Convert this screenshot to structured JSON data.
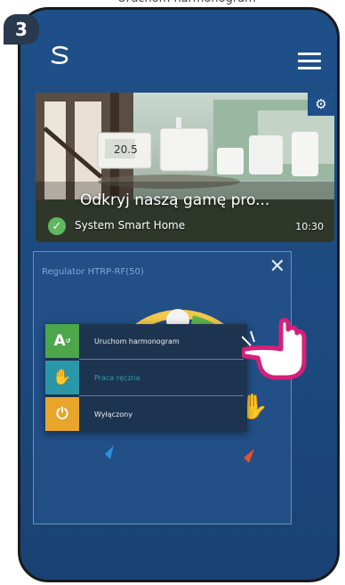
{
  "top_caption": "Uruchom harmonogram",
  "step_number": "3",
  "app_bar": {
    "logo_icon": "salus-s-logo",
    "menu_icon": "hamburger-icon"
  },
  "banner": {
    "title": "Odkryj naszą gamę pro...",
    "subtitle": "System Smart Home",
    "time": "10:30",
    "gear_icon": "gear-icon",
    "check_icon": "check-circle-icon",
    "thermostat_display": "20.5"
  },
  "dialog": {
    "title": "Regulator HTRP-RF(50)",
    "close_icon": "close-icon",
    "mode_icon": "hand-icon"
  },
  "menu": {
    "items": [
      {
        "label": "Uruchom harmonogram",
        "icon": "schedule-a-icon",
        "color": "#4ca74a",
        "glyph": "A"
      },
      {
        "label": "Praca ręczna",
        "icon": "hand-icon",
        "color": "#2a97a8",
        "glyph": "✋"
      },
      {
        "label": "Wyłączony",
        "icon": "power-icon",
        "color": "#e8a52b",
        "glyph": "⏻"
      }
    ]
  },
  "colors": {
    "app_blue": "#1e4f88",
    "menu_bg": "#1d3450",
    "finger_pink": "#d4207a"
  }
}
